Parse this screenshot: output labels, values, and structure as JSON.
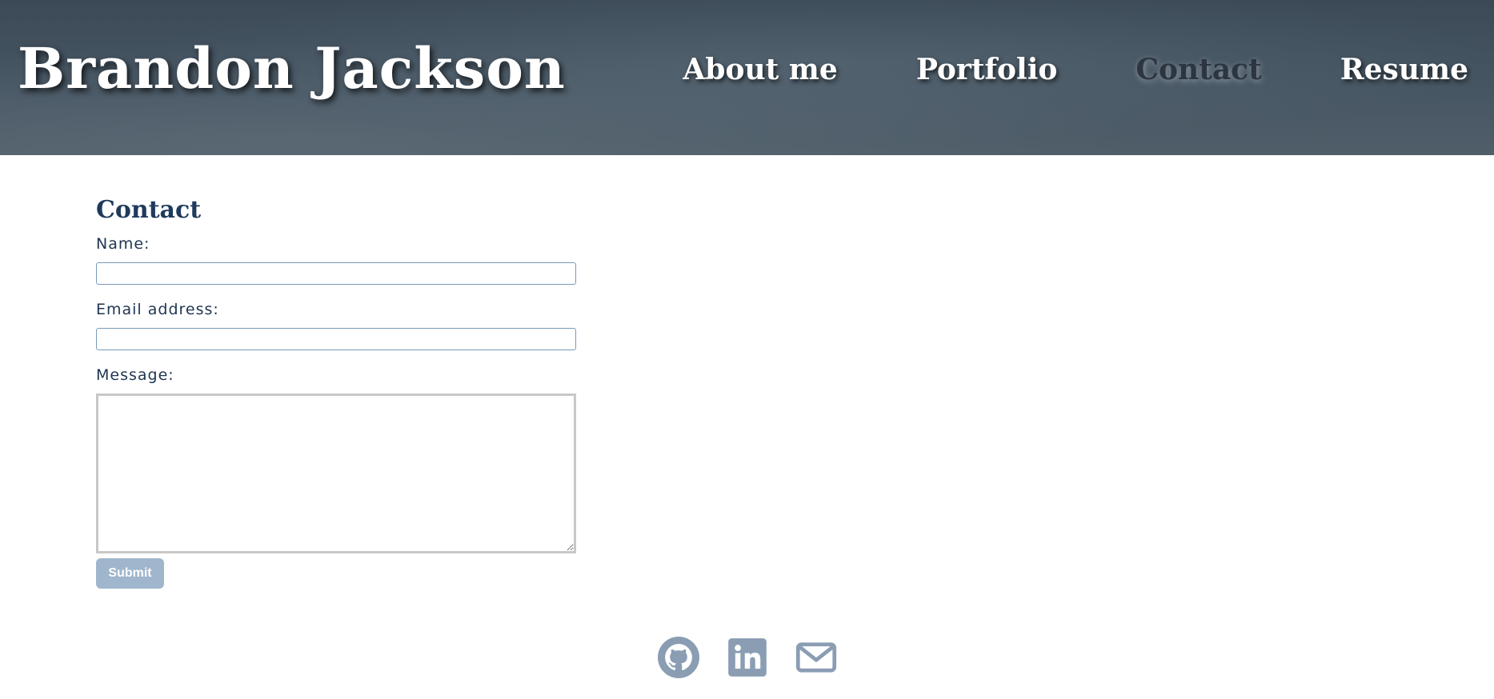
{
  "header": {
    "site_title": "Brandon Jackson",
    "nav": [
      {
        "label": "About me",
        "active": false
      },
      {
        "label": "Portfolio",
        "active": false
      },
      {
        "label": "Contact",
        "active": true
      },
      {
        "label": "Resume",
        "active": false
      }
    ]
  },
  "contact": {
    "heading": "Contact",
    "name_label": "Name:",
    "name_value": "",
    "email_label": "Email address:",
    "email_value": "",
    "message_label": "Message:",
    "message_value": "",
    "submit_label": "Submit"
  },
  "footer": {
    "icons": [
      "github-icon",
      "linkedin-icon",
      "mail-icon"
    ],
    "icon_color": "#8a9db3"
  },
  "colors": {
    "header_bg": "#3f4d5a",
    "heading": "#1e3a5c",
    "submit_bg": "#9fb6cc",
    "nav_active": "#2c3540"
  }
}
